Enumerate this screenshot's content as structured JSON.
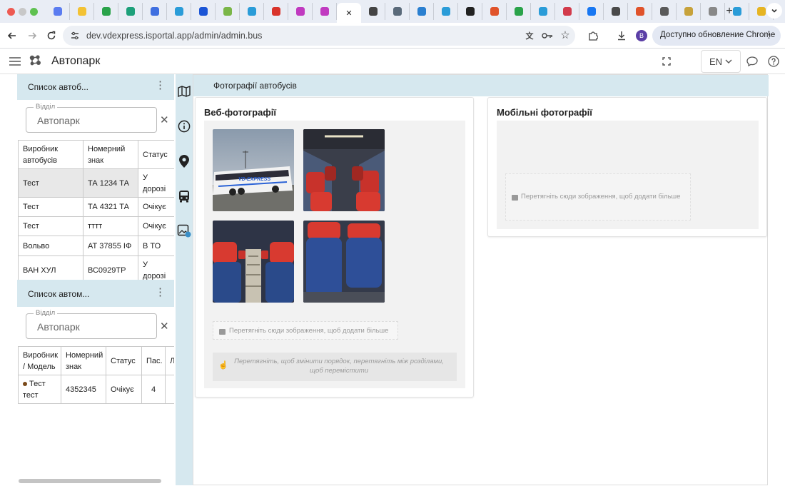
{
  "browser": {
    "url": "dev.vdexpress.isportal.app/admin/admin.bus",
    "update_label": "Доступно обновление Chrome",
    "profile_initial": "B",
    "tab_colors": [
      "#5b7cf0",
      "#f3c234",
      "#2aa34a",
      "#1da07a",
      "#3f6fe0",
      "#2a9cd8",
      "#1b55d6",
      "#7ab648",
      "#2a9cd8",
      "#d9342b",
      "#c03ac0",
      "#c03ac0",
      "#444444",
      "#5a6a7a",
      "#2a7fd0",
      "#2a9cd8",
      "#222222",
      "#e0532b",
      "#2aa34a",
      "#2a9cd8",
      "#d23b4b",
      "#1877f2",
      "#4a4a4a",
      "#e0532b",
      "#5a5a5a",
      "#c7a23b",
      "#888888",
      "#2a9cd8",
      "#e6b422"
    ]
  },
  "app": {
    "title": "Автопарк",
    "lang": "EN"
  },
  "bus_list": {
    "title": "Список автоб...",
    "filter_label": "Відділ",
    "filter_value": "Автопарк",
    "headers": [
      "Виробник автобусів",
      "Номерний знак",
      "Статус"
    ],
    "rows": [
      {
        "maker": "Тест",
        "plate": "ТА 1234 ТА",
        "status": "У дорозі"
      },
      {
        "maker": "Тест",
        "plate": "ТА 4321 ТА",
        "status": "Очікує"
      },
      {
        "maker": "Тест",
        "plate": "тттт",
        "status": "Очікує"
      },
      {
        "maker": "Вольво",
        "plate": "АТ 37855 ІФ",
        "status": "В ТО"
      },
      {
        "maker": "ВАН ХУЛ",
        "plate": "ВС0929ТР",
        "status": "У дорозі"
      }
    ]
  },
  "auto_list": {
    "title": "Список автом...",
    "filter_label": "Відділ",
    "filter_value": "Автопарк",
    "headers": [
      "Виробник / Модель",
      "Номерний знак",
      "Статус",
      "Пас.",
      "Л"
    ],
    "rows": [
      {
        "model": "Тест тест",
        "plate": "4352345",
        "status": "Очікує",
        "pax": "4"
      }
    ]
  },
  "main": {
    "section_title": "Фотографії автобусів",
    "web_title": "Веб-фотографії",
    "mobile_title": "Мобільні фотографії",
    "drop_text": "Перетягніть сюди зображення, щоб додати більше",
    "hint_text": "Перетягніть, щоб змінити порядок, перетягніть між розділами, щоб перемістити"
  }
}
